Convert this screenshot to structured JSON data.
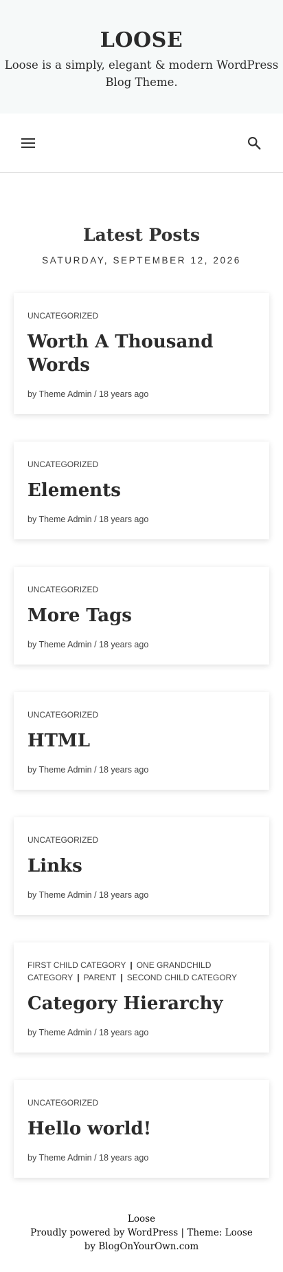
{
  "header": {
    "title": "LOOSE",
    "description": "Loose is a simply, elegant & modern WordPress Blog Theme."
  },
  "nav": {
    "menu_icon": "menu-icon",
    "search_icon": "search-icon"
  },
  "section": {
    "title": "Latest Posts",
    "date": "SATURDAY, SEPTEMBER 12, 2026"
  },
  "posts": [
    {
      "categories": [
        "UNCATEGORIZED"
      ],
      "title": "Worth A Thousand Words",
      "author": "by Theme Admin",
      "sep": "/",
      "time": "18 years ago"
    },
    {
      "categories": [
        "UNCATEGORIZED"
      ],
      "title": "Elements",
      "author": "by Theme Admin",
      "sep": "/",
      "time": "18 years ago"
    },
    {
      "categories": [
        "UNCATEGORIZED"
      ],
      "title": "More Tags",
      "author": "by Theme Admin",
      "sep": "/",
      "time": "18 years ago"
    },
    {
      "categories": [
        "UNCATEGORIZED"
      ],
      "title": "HTML",
      "author": "by Theme Admin",
      "sep": "/",
      "time": "18 years ago"
    },
    {
      "categories": [
        "UNCATEGORIZED"
      ],
      "title": "Links",
      "author": "by Theme Admin",
      "sep": "/",
      "time": "18 years ago"
    },
    {
      "categories": [
        "FIRST CHILD CATEGORY",
        "ONE GRANDCHILD CATEGORY",
        "PARENT",
        "SECOND CHILD CATEGORY"
      ],
      "title": "Category Hierarchy",
      "author": "by Theme Admin",
      "sep": "/",
      "time": "18 years ago"
    },
    {
      "categories": [
        "UNCATEGORIZED"
      ],
      "title": "Hello world!",
      "author": "by Theme Admin",
      "sep": "/",
      "time": "18 years ago"
    }
  ],
  "footer": {
    "site": "Loose",
    "powered": "Proudly powered by WordPress",
    "divider": "|",
    "theme": "Theme: Loose by BlogOnYourOwn.com"
  }
}
